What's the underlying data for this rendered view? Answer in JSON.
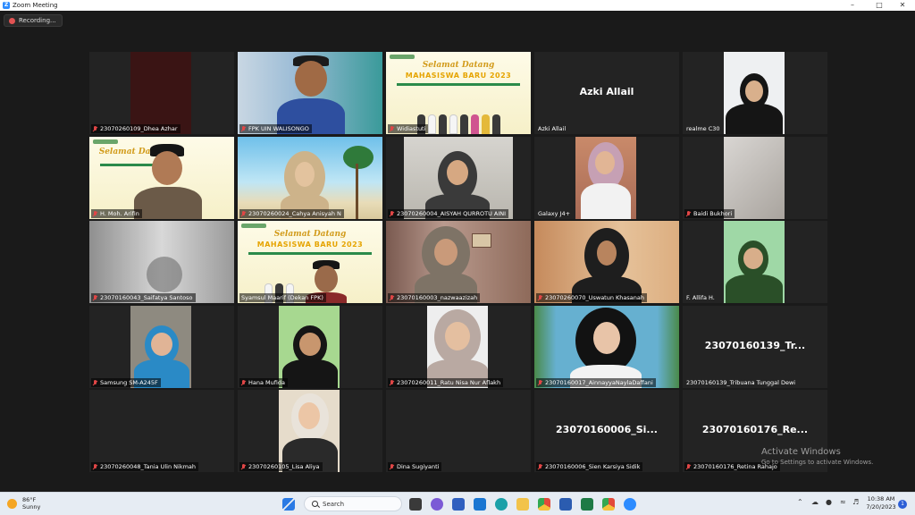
{
  "window": {
    "title": "Zoom Meeting",
    "icon": "zoom-icon"
  },
  "recording": {
    "label": "Recording..."
  },
  "tiles": [
    {
      "name": "23070260109_Dhea Azhar",
      "big": ""
    },
    {
      "name": "FPK UIN WALISONGO",
      "big": ""
    },
    {
      "name": "Widiastuti",
      "big": ""
    },
    {
      "name": "Azki Allail",
      "big": "Azki Allail"
    },
    {
      "name": "realme C30",
      "big": ""
    },
    {
      "name": "H. Moh. Arifin",
      "big": ""
    },
    {
      "name": "23070260024_Cahya Anisyah N",
      "big": ""
    },
    {
      "name": "23070260004_AISYAH QURROTU AINI",
      "big": ""
    },
    {
      "name": "Galaxy J4+",
      "big": ""
    },
    {
      "name": "Baidi Bukhori",
      "big": ""
    },
    {
      "name": "23070160043_Saifatya Santoso",
      "big": ""
    },
    {
      "name": "Syamsul Maarif (Dekan FPK)",
      "big": ""
    },
    {
      "name": "23070160003_nazwaazizah",
      "big": ""
    },
    {
      "name": "23070260070_Uswatun Khasanah",
      "big": ""
    },
    {
      "name": "F. Allifa H.",
      "big": ""
    },
    {
      "name": "Samsung SM-A245F",
      "big": ""
    },
    {
      "name": "Hana Mufida",
      "big": ""
    },
    {
      "name": "23070260011_Ratu Nisa Nur Aflakh",
      "big": ""
    },
    {
      "name": "23070160017_AinnayyaNaylaDaffani",
      "big": ""
    },
    {
      "name": "23070160139_Tribuana Tunggal Dewi",
      "big": "23070160139_Tr..."
    },
    {
      "name": "23070260048_Tania Ulin Nikmah",
      "big": ""
    },
    {
      "name": "23070260105_Lisa Aliya",
      "big": ""
    },
    {
      "name": "Dina Sugiyanti",
      "big": ""
    },
    {
      "name": "23070160006_Sien Karsiya Sidik",
      "big": "23070160006_Si..."
    },
    {
      "name": "23070160176_Retina Rahajo",
      "big": "23070160176_Re..."
    }
  ],
  "banner": {
    "line1": "Selamat Datang",
    "line2": "MAHASISWA BARU 2023"
  },
  "activate": {
    "title": "Activate Windows",
    "subtitle": "Go to Settings to activate Windows."
  },
  "taskbar": {
    "weather_temp": "86°F",
    "weather_desc": "Sunny",
    "search_placeholder": "Search",
    "time": "10:38 AM",
    "date": "7/20/2023",
    "notifications": "1"
  },
  "colors": {
    "accent": "#2d8cff",
    "active_speaker": "#d7e54a",
    "muted": "#e04646"
  }
}
